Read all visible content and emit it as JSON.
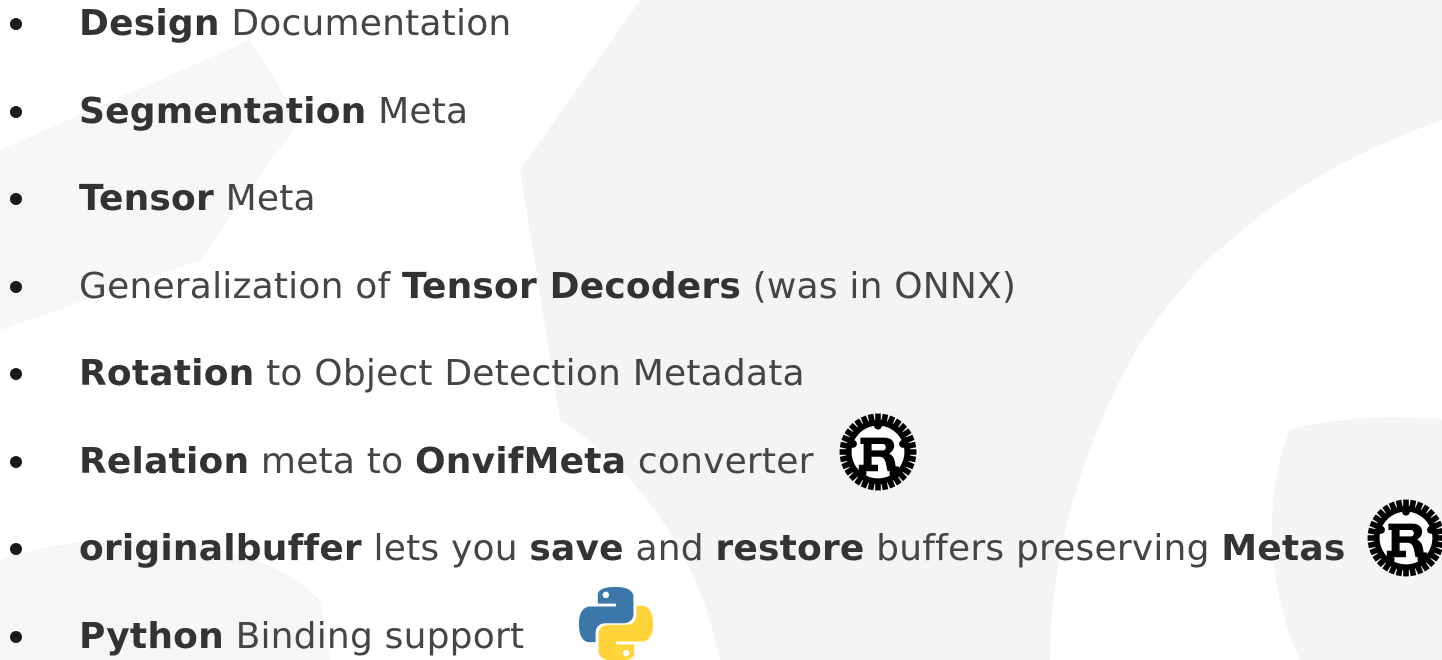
{
  "bullets": [
    {
      "parts": [
        {
          "t": "Design",
          "b": true
        },
        {
          "t": " Documentation",
          "b": false
        }
      ]
    },
    {
      "parts": [
        {
          "t": "Segmentation",
          "b": true
        },
        {
          "t": " Meta",
          "b": false
        }
      ]
    },
    {
      "parts": [
        {
          "t": "Tensor",
          "b": true
        },
        {
          "t": " Meta",
          "b": false
        }
      ]
    },
    {
      "parts": [
        {
          "t": "Generalization of ",
          "b": false
        },
        {
          "t": "Tensor Decoders",
          "b": true
        },
        {
          "t": " (was in ONNX)",
          "b": false
        }
      ]
    },
    {
      "parts": [
        {
          "t": "Rotation",
          "b": true
        },
        {
          "t": " to Object Detection Metadata",
          "b": false
        }
      ]
    },
    {
      "parts": [
        {
          "t": "Relation",
          "b": true
        },
        {
          "t": " meta to ",
          "b": false
        },
        {
          "t": "OnvifMeta",
          "b": true
        },
        {
          "t": " converter",
          "b": false
        }
      ],
      "icon": "rust-logo-icon"
    },
    {
      "parts": [
        {
          "t": "originalbuffer",
          "b": true
        },
        {
          "t": " lets you ",
          "b": false
        },
        {
          "t": "save",
          "b": true
        },
        {
          "t": " and ",
          "b": false
        },
        {
          "t": "restore",
          "b": true
        },
        {
          "t": " buffers preserving ",
          "b": false
        },
        {
          "t": "Metas",
          "b": true
        }
      ],
      "icon": "rust-logo-icon"
    },
    {
      "parts": [
        {
          "t": "Python",
          "b": true
        },
        {
          "t": " Binding support",
          "b": false
        }
      ],
      "icon": "python-logo-icon"
    }
  ],
  "colors": {
    "text": "#3a3a3a",
    "bold_text": "#333333",
    "bullet": "#1a1a1a",
    "background_shape": "#f2f2f2",
    "python_blue": "#3b77a8",
    "python_yellow": "#ffd43b"
  }
}
